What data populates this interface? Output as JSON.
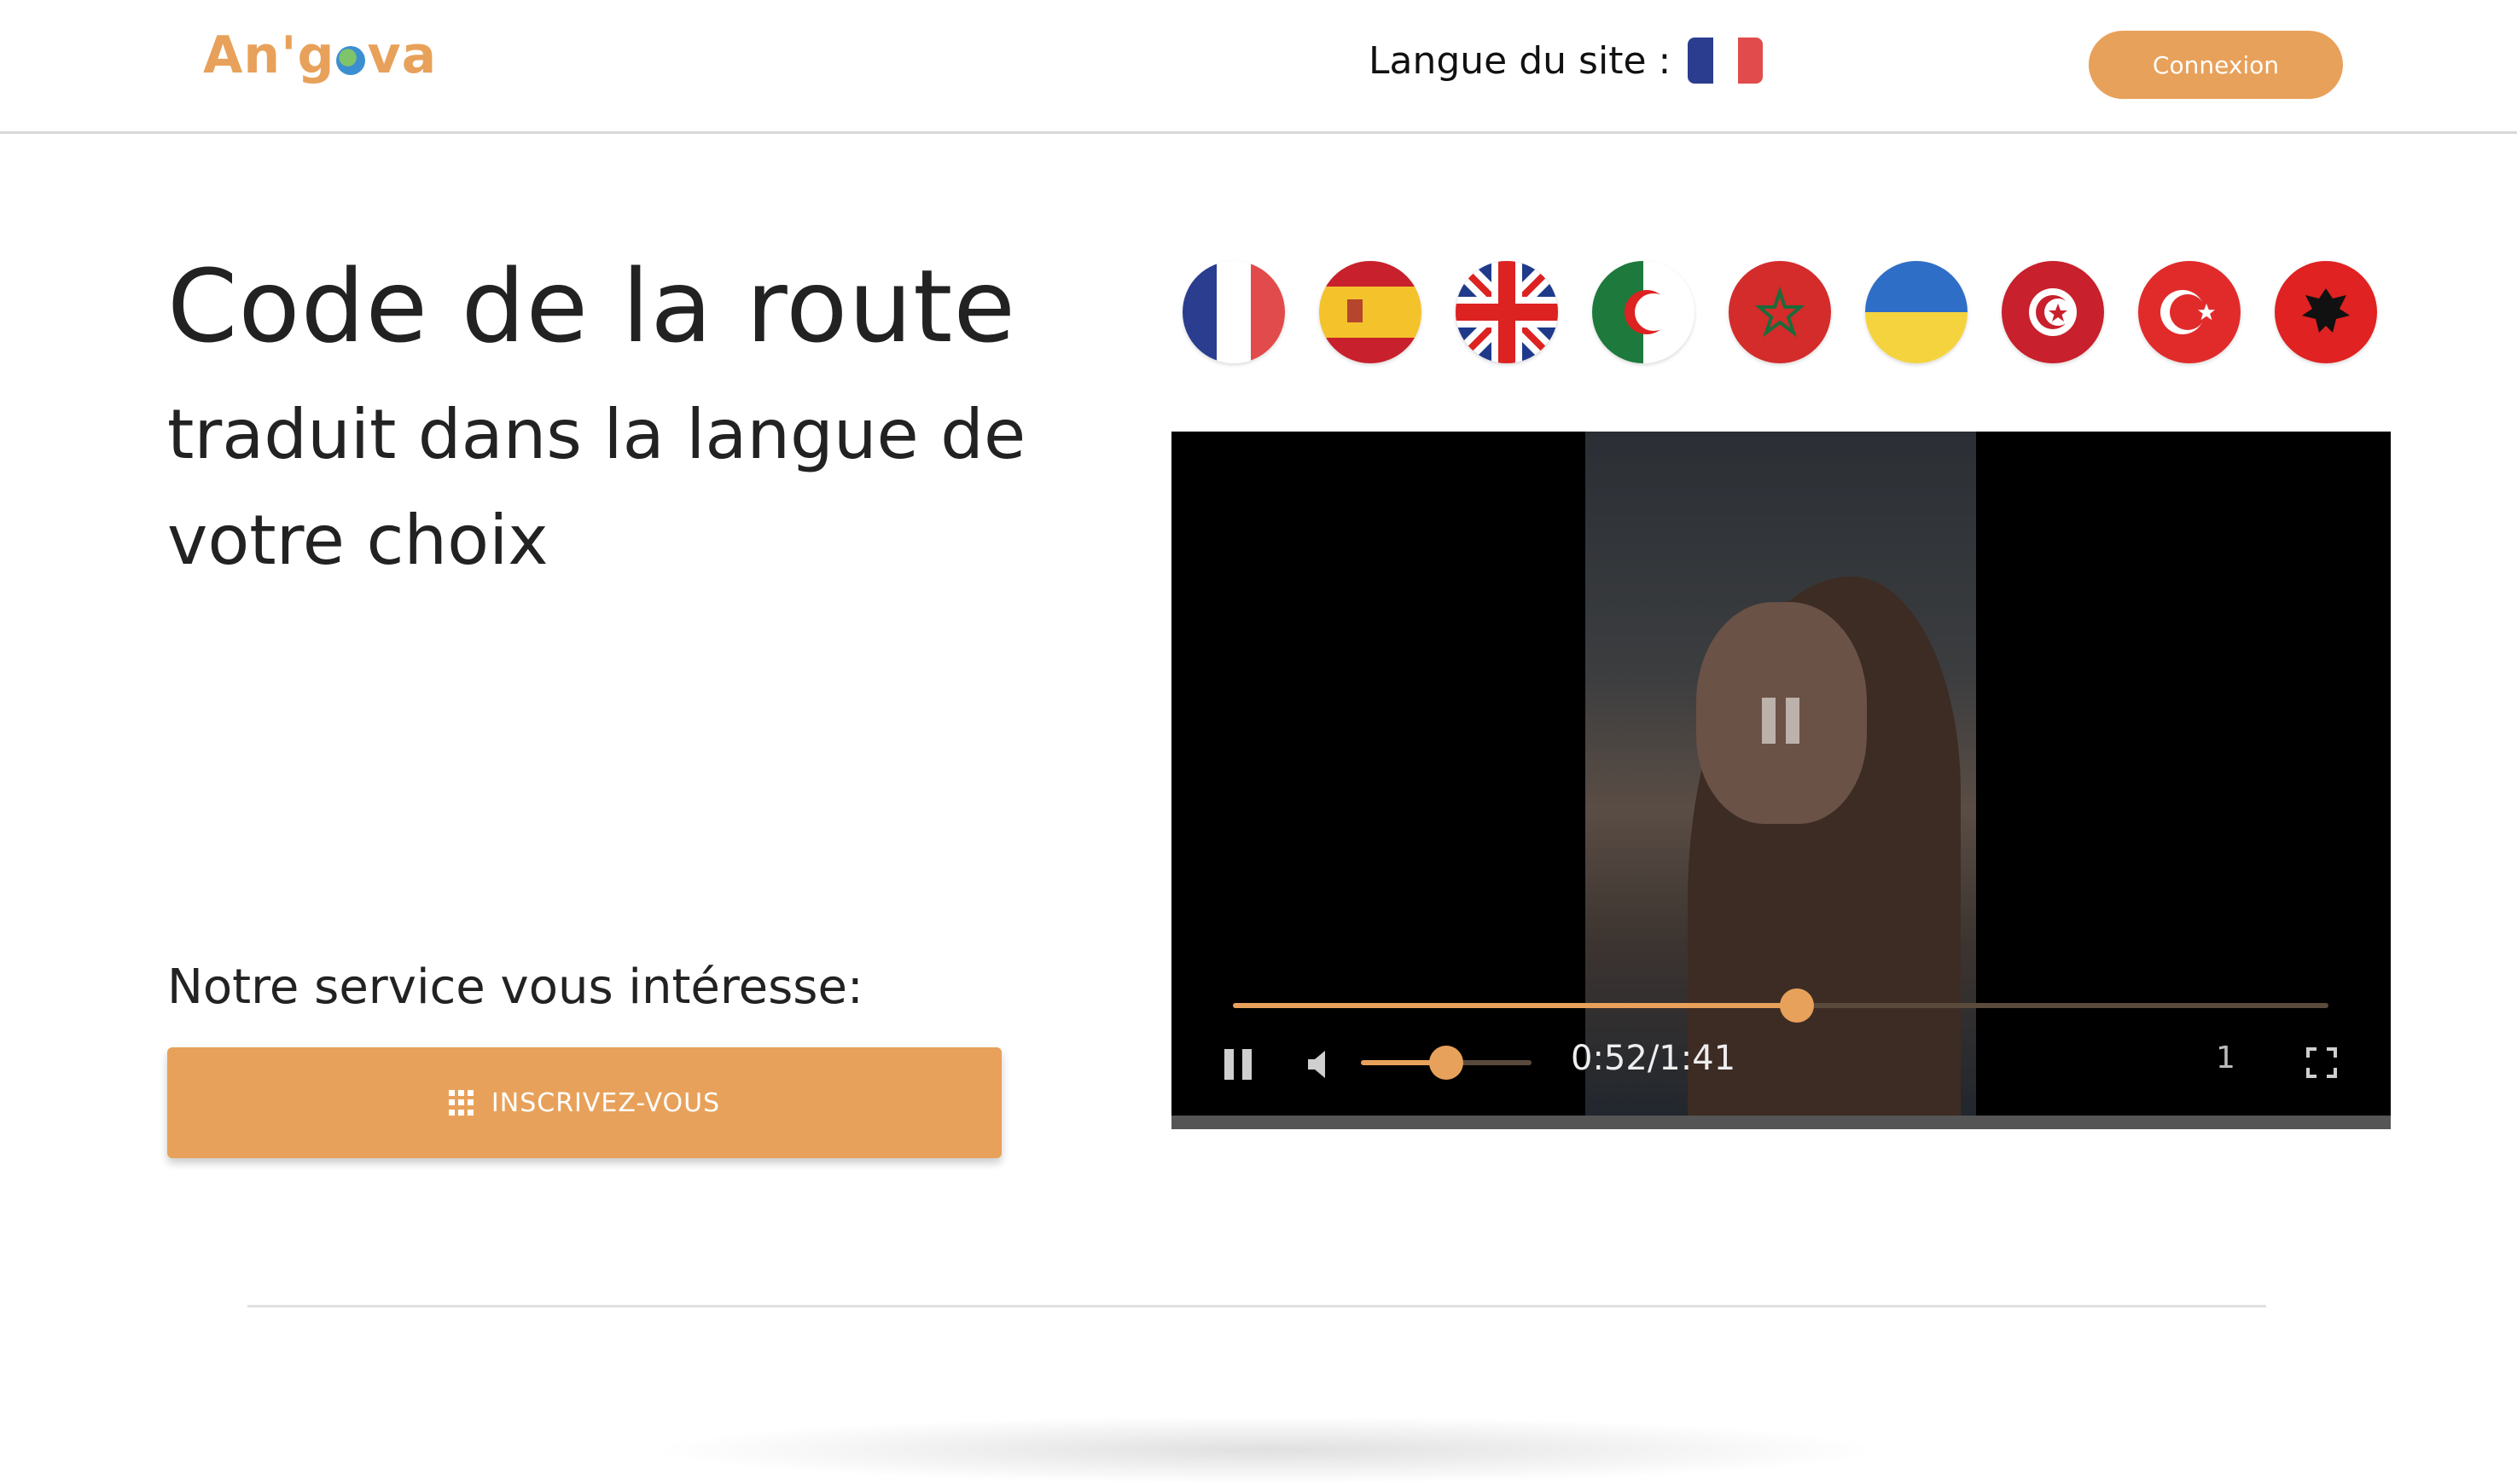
{
  "header": {
    "logo_text_a": "An'g",
    "logo_text_b": "va",
    "site_language_label": "Langue du site :",
    "login_label": "Connexion"
  },
  "hero": {
    "title": "Code de la route",
    "subtitle": "traduit dans la langue de votre choix",
    "interest_text": "Notre service vous intéresse:",
    "signup_label": "INSCRIVEZ-VOUS"
  },
  "languages": [
    {
      "name": "france-flag"
    },
    {
      "name": "spain-flag"
    },
    {
      "name": "united-kingdom-flag"
    },
    {
      "name": "algeria-flag"
    },
    {
      "name": "morocco-flag"
    },
    {
      "name": "ukraine-flag"
    },
    {
      "name": "tunisia-flag"
    },
    {
      "name": "turkey-flag"
    },
    {
      "name": "albania-flag"
    }
  ],
  "video": {
    "time_display": "0:52/1:41",
    "progress_fraction": 0.515,
    "volume_fraction": 0.5,
    "speed_label": "1"
  },
  "colors": {
    "accent": "#e8a15a"
  }
}
